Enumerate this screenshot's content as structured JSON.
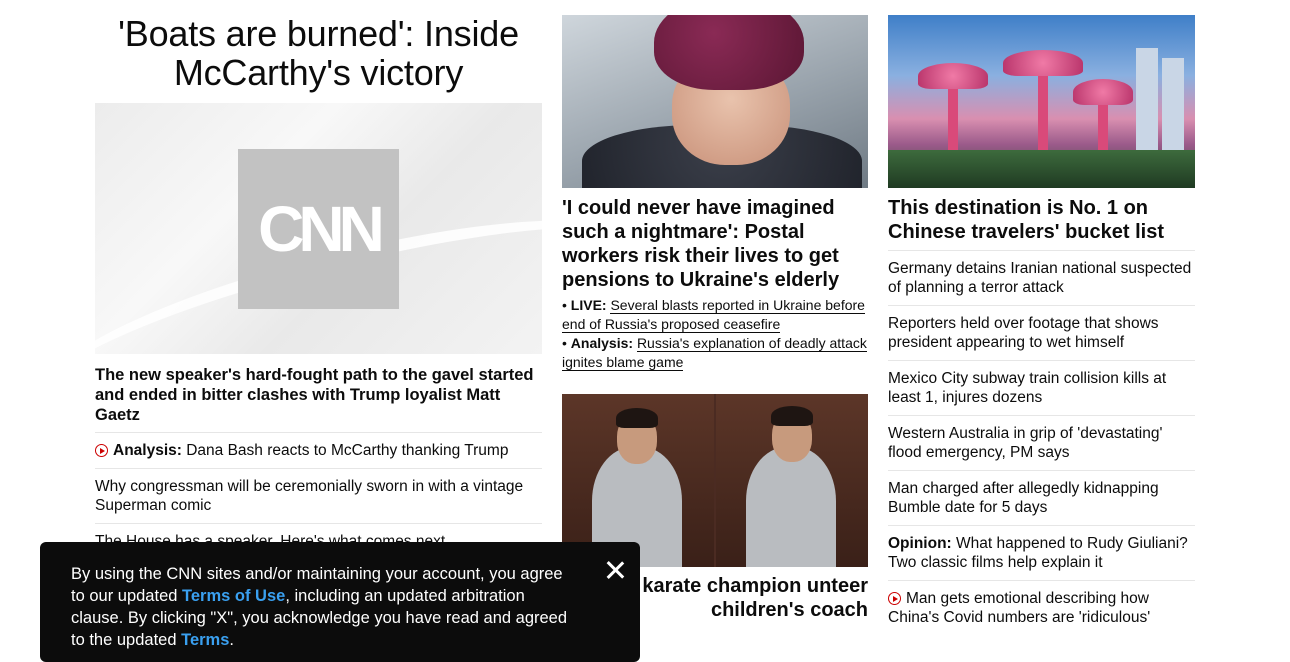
{
  "lead": {
    "title": "'Boats are burned': Inside McCarthy's victory",
    "image_label": "CNN",
    "subtitle": "The new speaker's hard-fought path to the gavel started and ended in bitter clashes with Trump loyalist Matt Gaetz",
    "related": [
      {
        "label": "Analysis:",
        "text": "Dana Bash reacts to McCarthy thanking Trump",
        "icon": "play-icon"
      },
      {
        "text": "Why congressman will be ceremonially sworn in with a vintage Superman comic"
      },
      {
        "text": "The House has a speaker. Here's what comes next"
      }
    ]
  },
  "middle": {
    "story1": {
      "headline": "'I could never have imagined such a nightmare': Postal workers risk their lives to get pensions to Ukraine's elderly",
      "bullets": [
        {
          "label": "LIVE:",
          "text": "Several blasts reported in Ukraine before end of Russia's proposed ceasefire"
        },
        {
          "label": "Analysis:",
          "text": "Russia's explanation of deadly attack ignites blame game"
        }
      ]
    },
    "story2": {
      "headline": "cutes karate champion unteer children's coach"
    }
  },
  "right": {
    "story": {
      "headline": "This destination is No. 1 on Chinese travelers' bucket list"
    },
    "list": [
      {
        "text": "Germany detains Iranian national suspected of planning a terror attack"
      },
      {
        "text": "Reporters held over footage that shows president appearing to wet himself"
      },
      {
        "text": "Mexico City subway train collision kills at least 1, injures dozens"
      },
      {
        "text": "Western Australia in grip of 'devastating' flood emergency, PM says"
      },
      {
        "text": "Man charged after allegedly kidnapping Bumble date for 5 days"
      },
      {
        "label": "Opinion:",
        "text": "What happened to Rudy Giuliani? Two classic films help explain it"
      },
      {
        "text": "Man gets emotional describing how China's Covid numbers are 'ridiculous'",
        "icon": "play-icon"
      }
    ]
  },
  "consent": {
    "text1": "By using the CNN sites and/or maintaining your account, you agree to our updated ",
    "link1": "Terms of Use",
    "text2": ", including an updated arbitration clause. By clicking \"X\", you acknowledge you have read and agreed to the updated ",
    "link2": "Terms",
    "text3": "."
  },
  "colors": {
    "accent_red": "#cc0000",
    "link_blue": "#3aa0f0",
    "banner_bg": "#0c0c0c"
  }
}
